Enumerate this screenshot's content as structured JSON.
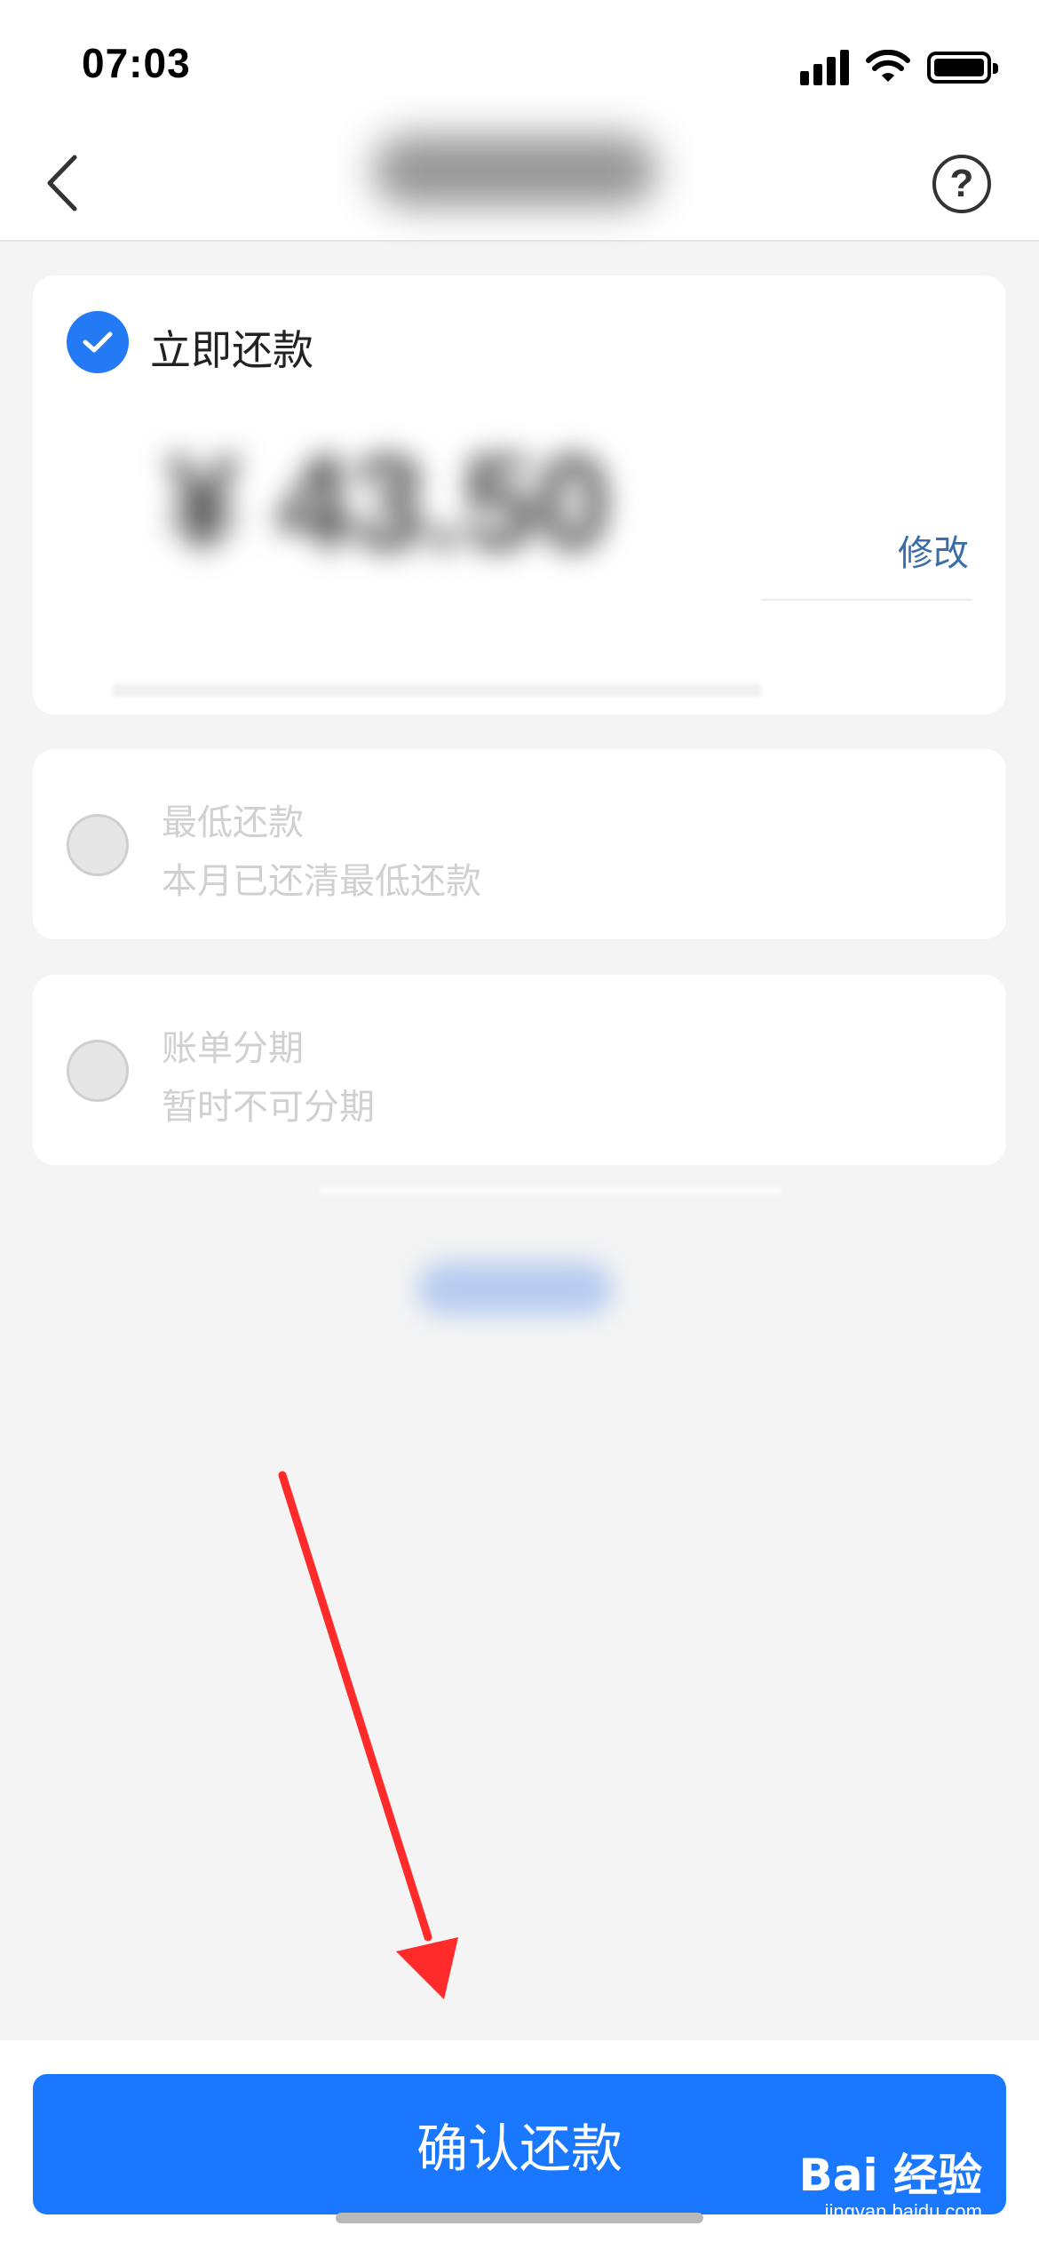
{
  "status_bar": {
    "time": "07:03"
  },
  "nav": {
    "help_symbol": "?"
  },
  "options": [
    {
      "title": "立即还款",
      "edit_label": "修改",
      "selected": true
    },
    {
      "title": "最低还款",
      "subtitle": "本月已还清最低还款",
      "selected": false
    },
    {
      "title": "账单分期",
      "subtitle": "暂时不可分期",
      "selected": false
    }
  ],
  "amount_blurred": "¥ 43.50",
  "confirm_button": {
    "label": "确认还款"
  },
  "watermark": {
    "logo": "Bai 经验",
    "url": "jingyan.baidu.com"
  },
  "colors": {
    "primary": "#1a77ff",
    "check": "#2479f4",
    "arrow": "#ff2a2a",
    "link": "#3a6ea8"
  },
  "icons": [
    "back-chevron-icon",
    "help-icon",
    "check-icon",
    "signal-icon",
    "wifi-icon",
    "battery-icon"
  ]
}
